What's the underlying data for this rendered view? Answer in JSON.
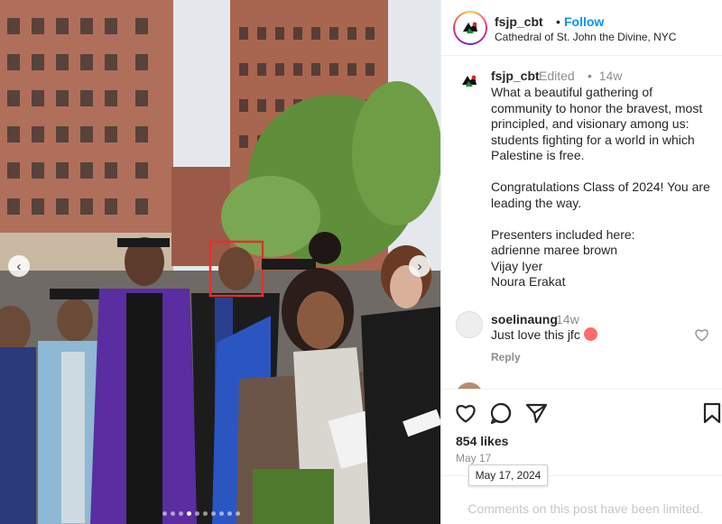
{
  "header": {
    "username": "fsjp_cbt",
    "separator": "•",
    "follow_label": "Follow",
    "location": "Cathedral of St. John the Divine, NYC"
  },
  "caption": {
    "username": "fsjp_cbt",
    "edited": "Edited",
    "separator": "•",
    "time": "14w",
    "lines": [
      "What a beautiful gathering of community to honor the bravest, most principled, and visionary among us: students fighting for a world in which Palestine is free.",
      "Congratulations Class of 2024! You are leading the way.",
      "Presenters included here:",
      "adrienne maree brown",
      "Vijay Iyer",
      "Noura Erakat"
    ]
  },
  "comment": {
    "username": "soelinaung",
    "time": "14w",
    "text": "Just love this jfc",
    "emoji": "star-struck-emoji",
    "reply_label": "Reply"
  },
  "peek_comment": {
    "text": ""
  },
  "actions": {
    "icons": [
      "heart-icon",
      "comment-bubble-icon",
      "send-icon",
      "bookmark-icon"
    ],
    "likes": "854 likes",
    "date": "May 17",
    "date_tooltip": "May 17, 2024"
  },
  "footer": {
    "limited_text": "Comments on this post have been limited."
  },
  "photo": {
    "highlight_color": "#e0312e",
    "gown_color": "#5a2da0"
  },
  "colors": {
    "accent": "#0095f6",
    "muted": "#8e8e8e"
  }
}
